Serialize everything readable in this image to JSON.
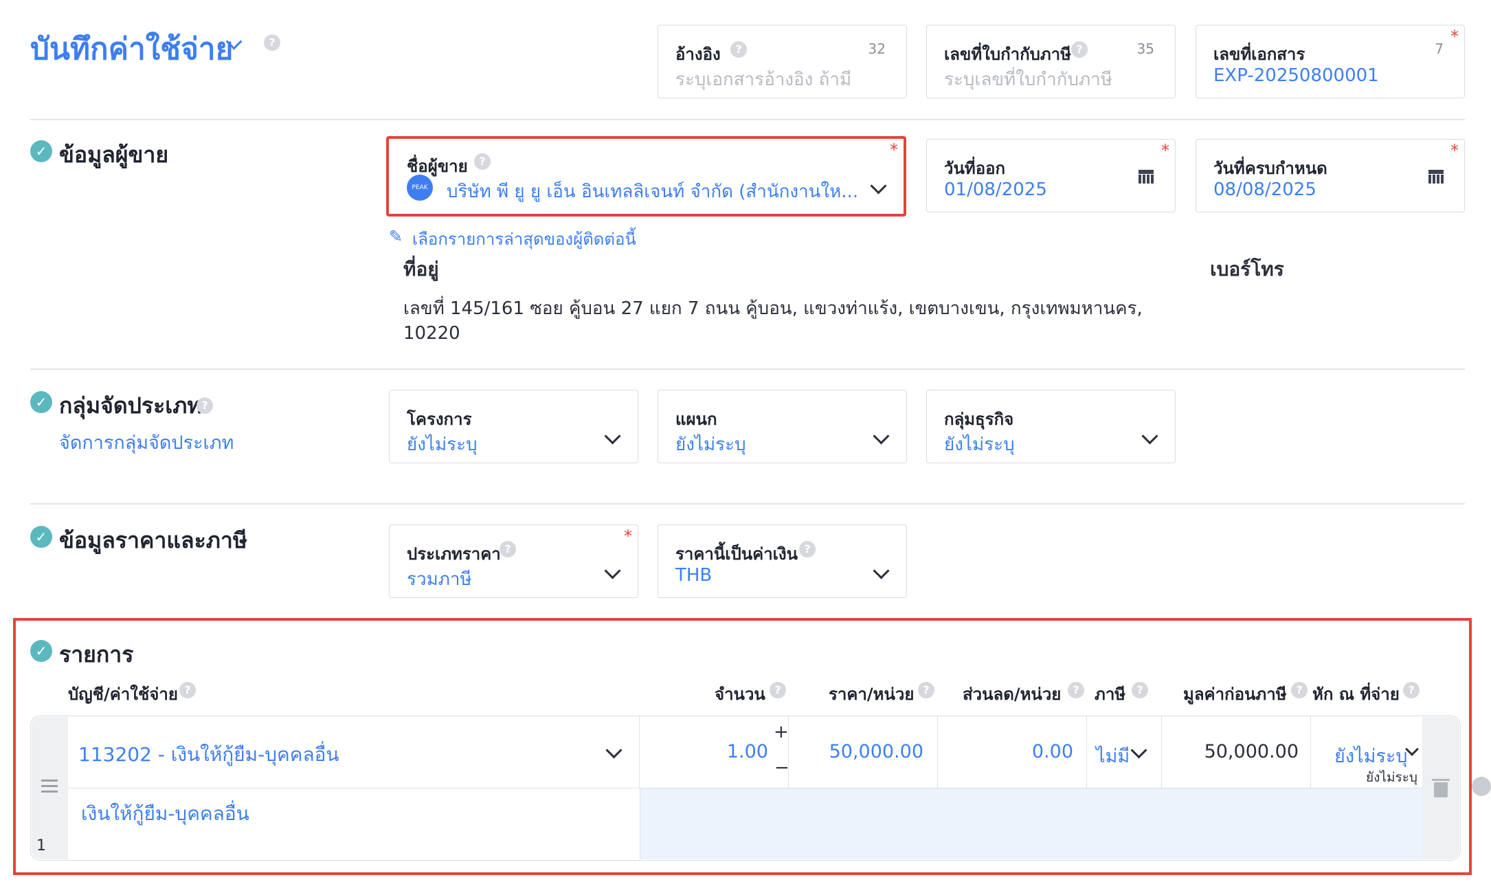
{
  "header": {
    "title": "บันทึกค่าใช้จ่าย",
    "reference": {
      "label": "อ้างอิง",
      "counter": "32",
      "placeholder": "ระบุเอกสารอ้างอิง ถ้ามี"
    },
    "tax_invoice": {
      "label": "เลขที่ใบกำกับภาษี",
      "counter": "35",
      "placeholder": "ระบุเลขที่ใบกำกับภาษี"
    },
    "document_no": {
      "label": "เลขที่เอกสาร",
      "counter": "7",
      "value": "EXP-20250800001"
    }
  },
  "vendor": {
    "section_title": "ข้อมูลผู้ขาย",
    "name_label": "ชื่อผู้ขาย",
    "avatar_text": "PEAK",
    "name_value": "บริษัท พี ยู ยู เอ็น อินเทลลิเจนท์ จำกัด (สำนักงานให...",
    "issue_date_label": "วันที่ออก",
    "issue_date": "01/08/2025",
    "due_date_label": "วันที่ครบกำหนด",
    "due_date": "08/08/2025",
    "recent_link": "เลือกรายการล่าสุดของผู้ติดต่อนี้",
    "address_label": "ที่อยู่",
    "address_line1": "เลขที่ 145/161 ซอย คู้บอน 27 แยก 7 ถนน คู้บอน, แขวงท่าแร้ง, เขตบางเขน, กรุงเทพมหานคร,",
    "address_line2": "10220",
    "phone_label": "เบอร์โทร"
  },
  "classification": {
    "section_title": "กลุ่มจัดประเภท",
    "manage_link": "จัดการกลุ่มจัดประเภท",
    "project_label": "โครงการ",
    "project_value": "ยังไม่ระบุ",
    "department_label": "แผนก",
    "department_value": "ยังไม่ระบุ",
    "business_label": "กลุ่มธุรกิจ",
    "business_value": "ยังไม่ระบุ"
  },
  "pricing": {
    "section_title": "ข้อมูลราคาและภาษี",
    "price_type_label": "ประเภทราคา",
    "price_type_value": "รวมภาษี",
    "currency_label": "ราคานี้เป็นค่าเงิน",
    "currency_value": "THB"
  },
  "items": {
    "section_title": "รายการ",
    "columns": {
      "account": "บัญชี/ค่าใช้จ่าย",
      "qty": "จำนวน",
      "unit_price": "ราคา/หน่วย",
      "discount": "ส่วนลด/หน่วย",
      "tax": "ภาษี",
      "pre_tax": "มูลค่าก่อนภาษี",
      "withholding": "หัก ณ ที่จ่าย"
    },
    "rows": [
      {
        "row_no": "1",
        "account": "113202 - เงินให้กู้ยืม-บุคคลอื่น",
        "description": "เงินให้กู้ยืม-บุคคลอื่น",
        "qty": "1.00",
        "unit_price": "50,000.00",
        "discount": "0.00",
        "tax": "ไม่มี",
        "pre_tax": "50,000.00",
        "withholding": "ยังไม่ระบุ",
        "withholding_sub": "ยังไม่ระบุ"
      }
    ]
  },
  "colors": {
    "accent": "#3d7ff2",
    "highlight": "#e0463a",
    "check": "#5cb8bf"
  }
}
